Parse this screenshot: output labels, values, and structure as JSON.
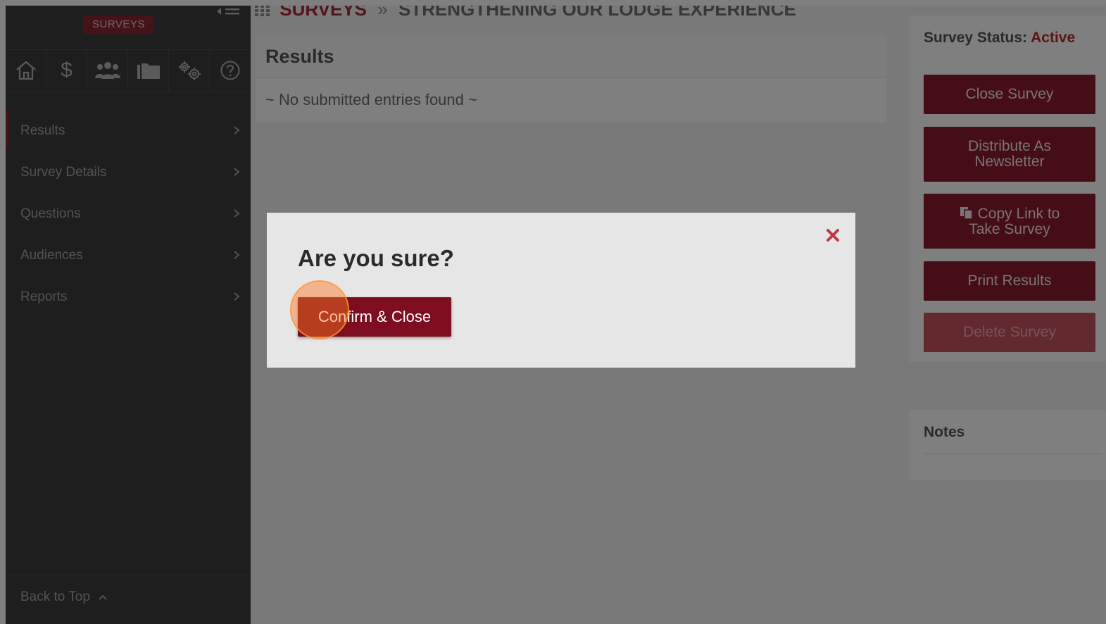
{
  "sidebar": {
    "module_badge": "SURVEYS",
    "icons": [
      "home-icon",
      "dollar-icon",
      "members-icon",
      "folder-icon",
      "settings-icon",
      "help-icon"
    ],
    "dollar_glyph": "$",
    "items": [
      {
        "label": "Results",
        "active": true
      },
      {
        "label": "Survey Details"
      },
      {
        "label": "Questions"
      },
      {
        "label": "Audiences"
      },
      {
        "label": "Reports"
      }
    ],
    "back_to_top": "Back to Top"
  },
  "breadcrumb": {
    "section": "SURVEYS",
    "separator": "»",
    "page": "STRENGTHENING OUR LODGE EXPERIENCE"
  },
  "results": {
    "title": "Results",
    "empty_message": "~ No submitted entries found ~"
  },
  "survey_status": {
    "label": "Survey Status:",
    "value": "Active",
    "value_color": "#b52a2f"
  },
  "actions": {
    "close_survey": "Close Survey",
    "distribute_line1": "Distribute As",
    "distribute_line2": "Newsletter",
    "copy_line1": "Copy Link to",
    "copy_line2": "Take Survey",
    "print_results": "Print Results",
    "delete_survey": "Delete Survey"
  },
  "notes": {
    "title": "Notes"
  },
  "modal": {
    "title": "Are you sure?",
    "confirm_label": "Confirm & Close",
    "close_icon": "close-icon"
  },
  "colors": {
    "brand": "#8a1b2c",
    "confirm": "#7d0d1f",
    "sidebar_bg": "#3c3c3c"
  }
}
